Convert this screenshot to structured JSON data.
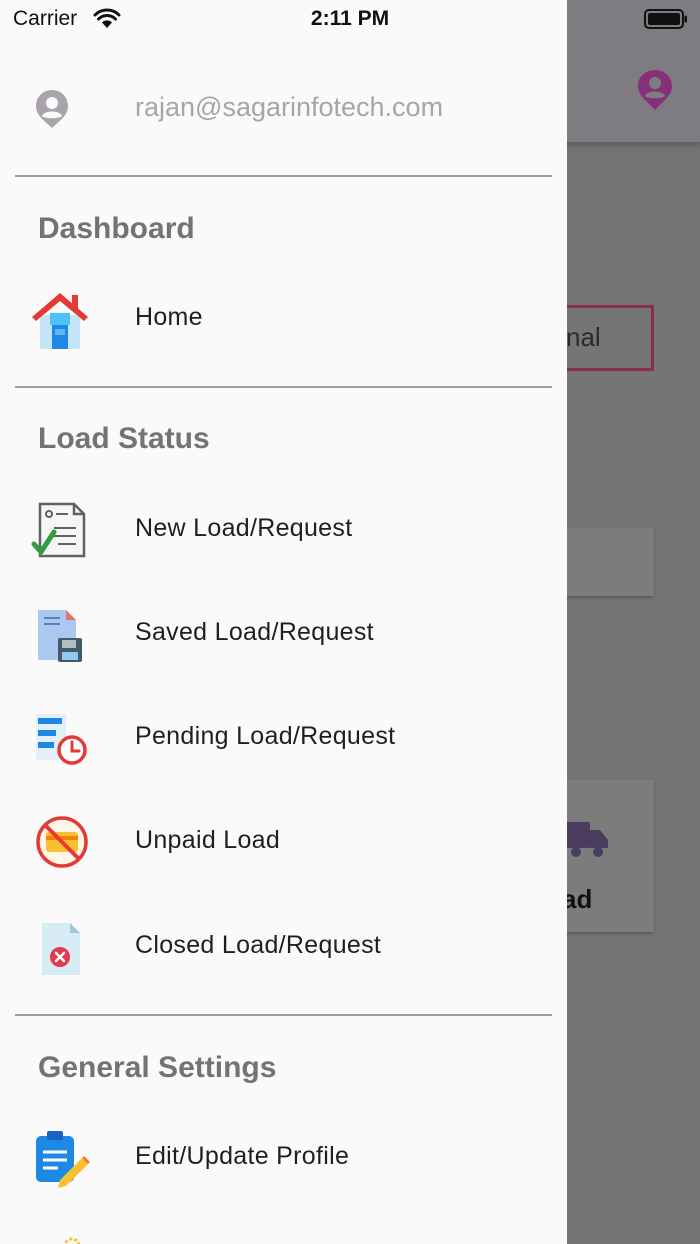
{
  "status_bar": {
    "carrier": "Carrier",
    "time": "2:11 PM"
  },
  "drawer": {
    "user_email": "rajan@sagarinfotech.com",
    "sections": [
      {
        "title": "Dashboard",
        "items": [
          {
            "label": "Home",
            "icon": "home-icon"
          }
        ]
      },
      {
        "title": "Load Status",
        "items": [
          {
            "label": "New Load/Request",
            "icon": "new-document-check-icon"
          },
          {
            "label": "Saved Load/Request",
            "icon": "saved-document-floppy-icon"
          },
          {
            "label": "Pending Load/Request",
            "icon": "pending-list-clock-icon"
          },
          {
            "label": "Unpaid Load",
            "icon": "no-card-payment-icon"
          },
          {
            "label": "Closed Load/Request",
            "icon": "closed-document-x-icon"
          }
        ]
      },
      {
        "title": "General Settings",
        "items": [
          {
            "label": "Edit/Update Profile",
            "icon": "clipboard-edit-icon"
          }
        ]
      }
    ]
  },
  "background": {
    "toggle_text_partial": "nal",
    "card_label_partial": "ad"
  },
  "colors": {
    "drawer_bg": "#fafafa",
    "scrim": "#757575",
    "accent": "#8a2c54",
    "section_title": "#737373"
  }
}
